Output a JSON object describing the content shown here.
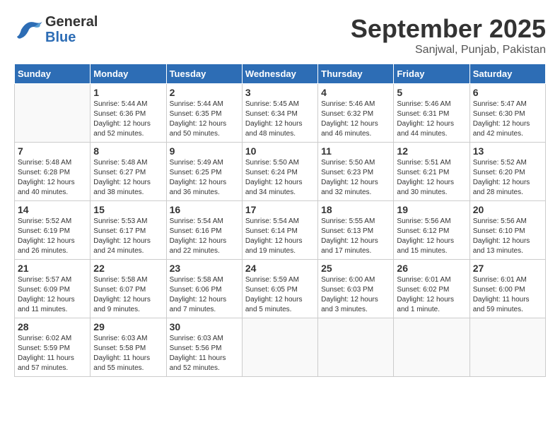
{
  "header": {
    "logo_general": "General",
    "logo_blue": "Blue",
    "month": "September 2025",
    "location": "Sanjwal, Punjab, Pakistan"
  },
  "weekdays": [
    "Sunday",
    "Monday",
    "Tuesday",
    "Wednesday",
    "Thursday",
    "Friday",
    "Saturday"
  ],
  "weeks": [
    [
      {
        "day": "",
        "sunrise": "",
        "sunset": "",
        "daylight": ""
      },
      {
        "day": "1",
        "sunrise": "Sunrise: 5:44 AM",
        "sunset": "Sunset: 6:36 PM",
        "daylight": "Daylight: 12 hours and 52 minutes."
      },
      {
        "day": "2",
        "sunrise": "Sunrise: 5:44 AM",
        "sunset": "Sunset: 6:35 PM",
        "daylight": "Daylight: 12 hours and 50 minutes."
      },
      {
        "day": "3",
        "sunrise": "Sunrise: 5:45 AM",
        "sunset": "Sunset: 6:34 PM",
        "daylight": "Daylight: 12 hours and 48 minutes."
      },
      {
        "day": "4",
        "sunrise": "Sunrise: 5:46 AM",
        "sunset": "Sunset: 6:32 PM",
        "daylight": "Daylight: 12 hours and 46 minutes."
      },
      {
        "day": "5",
        "sunrise": "Sunrise: 5:46 AM",
        "sunset": "Sunset: 6:31 PM",
        "daylight": "Daylight: 12 hours and 44 minutes."
      },
      {
        "day": "6",
        "sunrise": "Sunrise: 5:47 AM",
        "sunset": "Sunset: 6:30 PM",
        "daylight": "Daylight: 12 hours and 42 minutes."
      }
    ],
    [
      {
        "day": "7",
        "sunrise": "Sunrise: 5:48 AM",
        "sunset": "Sunset: 6:28 PM",
        "daylight": "Daylight: 12 hours and 40 minutes."
      },
      {
        "day": "8",
        "sunrise": "Sunrise: 5:48 AM",
        "sunset": "Sunset: 6:27 PM",
        "daylight": "Daylight: 12 hours and 38 minutes."
      },
      {
        "day": "9",
        "sunrise": "Sunrise: 5:49 AM",
        "sunset": "Sunset: 6:25 PM",
        "daylight": "Daylight: 12 hours and 36 minutes."
      },
      {
        "day": "10",
        "sunrise": "Sunrise: 5:50 AM",
        "sunset": "Sunset: 6:24 PM",
        "daylight": "Daylight: 12 hours and 34 minutes."
      },
      {
        "day": "11",
        "sunrise": "Sunrise: 5:50 AM",
        "sunset": "Sunset: 6:23 PM",
        "daylight": "Daylight: 12 hours and 32 minutes."
      },
      {
        "day": "12",
        "sunrise": "Sunrise: 5:51 AM",
        "sunset": "Sunset: 6:21 PM",
        "daylight": "Daylight: 12 hours and 30 minutes."
      },
      {
        "day": "13",
        "sunrise": "Sunrise: 5:52 AM",
        "sunset": "Sunset: 6:20 PM",
        "daylight": "Daylight: 12 hours and 28 minutes."
      }
    ],
    [
      {
        "day": "14",
        "sunrise": "Sunrise: 5:52 AM",
        "sunset": "Sunset: 6:19 PM",
        "daylight": "Daylight: 12 hours and 26 minutes."
      },
      {
        "day": "15",
        "sunrise": "Sunrise: 5:53 AM",
        "sunset": "Sunset: 6:17 PM",
        "daylight": "Daylight: 12 hours and 24 minutes."
      },
      {
        "day": "16",
        "sunrise": "Sunrise: 5:54 AM",
        "sunset": "Sunset: 6:16 PM",
        "daylight": "Daylight: 12 hours and 22 minutes."
      },
      {
        "day": "17",
        "sunrise": "Sunrise: 5:54 AM",
        "sunset": "Sunset: 6:14 PM",
        "daylight": "Daylight: 12 hours and 19 minutes."
      },
      {
        "day": "18",
        "sunrise": "Sunrise: 5:55 AM",
        "sunset": "Sunset: 6:13 PM",
        "daylight": "Daylight: 12 hours and 17 minutes."
      },
      {
        "day": "19",
        "sunrise": "Sunrise: 5:56 AM",
        "sunset": "Sunset: 6:12 PM",
        "daylight": "Daylight: 12 hours and 15 minutes."
      },
      {
        "day": "20",
        "sunrise": "Sunrise: 5:56 AM",
        "sunset": "Sunset: 6:10 PM",
        "daylight": "Daylight: 12 hours and 13 minutes."
      }
    ],
    [
      {
        "day": "21",
        "sunrise": "Sunrise: 5:57 AM",
        "sunset": "Sunset: 6:09 PM",
        "daylight": "Daylight: 12 hours and 11 minutes."
      },
      {
        "day": "22",
        "sunrise": "Sunrise: 5:58 AM",
        "sunset": "Sunset: 6:07 PM",
        "daylight": "Daylight: 12 hours and 9 minutes."
      },
      {
        "day": "23",
        "sunrise": "Sunrise: 5:58 AM",
        "sunset": "Sunset: 6:06 PM",
        "daylight": "Daylight: 12 hours and 7 minutes."
      },
      {
        "day": "24",
        "sunrise": "Sunrise: 5:59 AM",
        "sunset": "Sunset: 6:05 PM",
        "daylight": "Daylight: 12 hours and 5 minutes."
      },
      {
        "day": "25",
        "sunrise": "Sunrise: 6:00 AM",
        "sunset": "Sunset: 6:03 PM",
        "daylight": "Daylight: 12 hours and 3 minutes."
      },
      {
        "day": "26",
        "sunrise": "Sunrise: 6:01 AM",
        "sunset": "Sunset: 6:02 PM",
        "daylight": "Daylight: 12 hours and 1 minute."
      },
      {
        "day": "27",
        "sunrise": "Sunrise: 6:01 AM",
        "sunset": "Sunset: 6:00 PM",
        "daylight": "Daylight: 11 hours and 59 minutes."
      }
    ],
    [
      {
        "day": "28",
        "sunrise": "Sunrise: 6:02 AM",
        "sunset": "Sunset: 5:59 PM",
        "daylight": "Daylight: 11 hours and 57 minutes."
      },
      {
        "day": "29",
        "sunrise": "Sunrise: 6:03 AM",
        "sunset": "Sunset: 5:58 PM",
        "daylight": "Daylight: 11 hours and 55 minutes."
      },
      {
        "day": "30",
        "sunrise": "Sunrise: 6:03 AM",
        "sunset": "Sunset: 5:56 PM",
        "daylight": "Daylight: 11 hours and 52 minutes."
      },
      {
        "day": "",
        "sunrise": "",
        "sunset": "",
        "daylight": ""
      },
      {
        "day": "",
        "sunrise": "",
        "sunset": "",
        "daylight": ""
      },
      {
        "day": "",
        "sunrise": "",
        "sunset": "",
        "daylight": ""
      },
      {
        "day": "",
        "sunrise": "",
        "sunset": "",
        "daylight": ""
      }
    ]
  ]
}
